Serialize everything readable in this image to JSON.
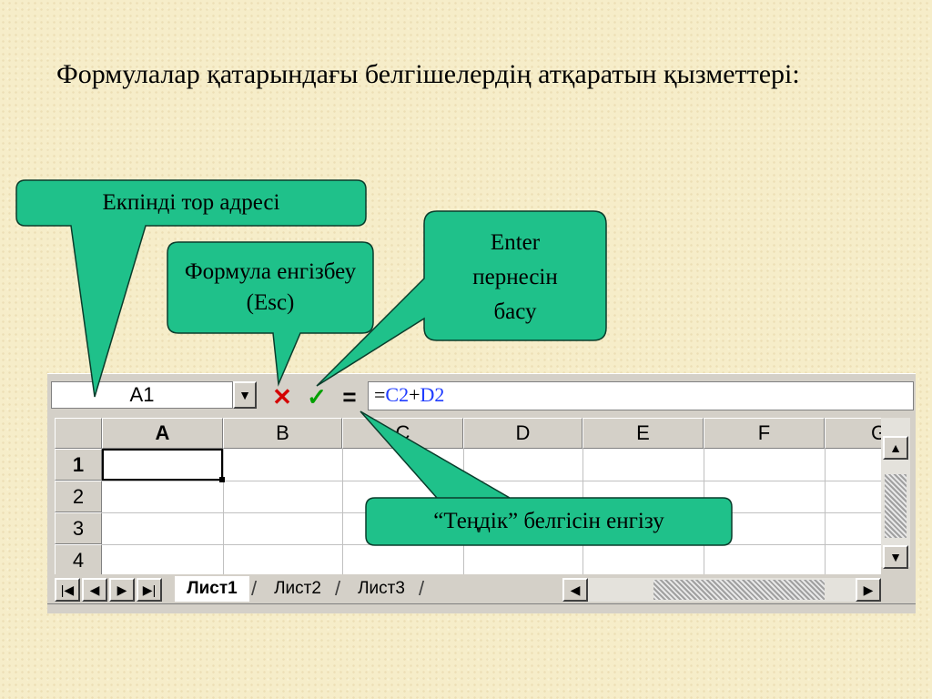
{
  "slide": {
    "title": "Формулалар қатарындағы белгішелердің атқаратын қызметтері:"
  },
  "callouts": {
    "cell_address": "Екпінді тор адресі",
    "cancel": "Формула енгізбеу (Esc)",
    "enter_line1": "Enter",
    "enter_line2": "пернесін",
    "enter_line3": "басу",
    "equals": "“Теңдік” белгісін енгізу"
  },
  "colors": {
    "callout_fill": "#1fc18a",
    "cancel_icon": "#d40000",
    "confirm_icon": "#00a000",
    "formula_ref": "#1f3cff"
  },
  "formula_bar": {
    "name_box": "A1",
    "dropdown_icon": "▼",
    "cancel_icon": "✕",
    "confirm_icon": "✓",
    "equals_icon": "=",
    "formula_eq": "=",
    "formula_ref1": "C2",
    "formula_op": "+",
    "formula_ref2": "D2"
  },
  "grid": {
    "columns": [
      "A",
      "B",
      "C",
      "D",
      "E",
      "F",
      "G"
    ],
    "rows": [
      "1",
      "2",
      "3",
      "4"
    ],
    "active_cell": "A1"
  },
  "scrollbar": {
    "up": "▲",
    "down": "▼",
    "left": "◀",
    "right": "▶"
  },
  "sheet_tabs": {
    "nav": [
      "|◀",
      "◀",
      "▶",
      "▶|"
    ],
    "tabs": [
      "Лист1",
      "Лист2",
      "Лист3"
    ],
    "active": "Лист1"
  }
}
